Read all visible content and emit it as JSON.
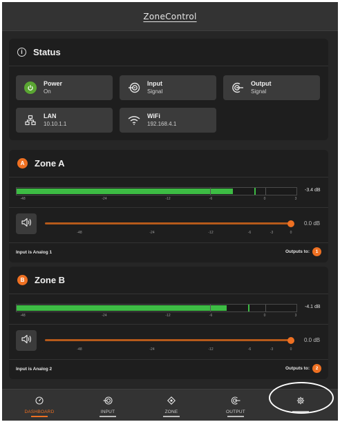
{
  "app": {
    "title": "ZoneControl"
  },
  "status": {
    "title": "Status",
    "tiles": [
      {
        "label": "Power",
        "value": "On",
        "icon": "power-icon",
        "color": "#5aa632"
      },
      {
        "label": "Input",
        "value": "Signal",
        "icon": "input-signal-icon"
      },
      {
        "label": "Output",
        "value": "Signal",
        "icon": "output-signal-icon"
      },
      {
        "label": "LAN",
        "value": "10.10.1.1",
        "icon": "lan-icon"
      },
      {
        "label": "WiFi",
        "value": "192.168.4.1",
        "icon": "wifi-icon"
      }
    ]
  },
  "zones": [
    {
      "badge": "A",
      "name": "Zone A",
      "meter_level_db": -3.4,
      "meter_readout": "-3.4 dB",
      "meter_scale": [
        "-48",
        "-24",
        "-12",
        "-6",
        "0",
        "3"
      ],
      "gain_db": 0.0,
      "gain_readout": "0.0 dB",
      "gain_scale": [
        "-48",
        "-24",
        "-12",
        "-6",
        "-3",
        "0"
      ],
      "input_text": "Input is Analog 1",
      "outputs_label": "Outputs to:",
      "outputs_badge": "1"
    },
    {
      "badge": "B",
      "name": "Zone B",
      "meter_level_db": -4.1,
      "meter_readout": "-4.1 dB",
      "meter_scale": [
        "-48",
        "-24",
        "-12",
        "-6",
        "0",
        "3"
      ],
      "gain_db": 0.0,
      "gain_readout": "0.0 dB",
      "gain_scale": [
        "-48",
        "-24",
        "-12",
        "-6",
        "-3",
        "0"
      ],
      "input_text": "Input is Analog 2",
      "outputs_label": "Outputs to:",
      "outputs_badge": "2"
    }
  ],
  "nav": {
    "items": [
      {
        "label": "DASHBOARD",
        "icon": "gauge-icon",
        "active": true
      },
      {
        "label": "INPUT",
        "icon": "input-icon",
        "active": false
      },
      {
        "label": "ZONE",
        "icon": "zone-icon",
        "active": false
      },
      {
        "label": "OUTPUT",
        "icon": "output-icon",
        "active": false
      },
      {
        "label": "",
        "icon": "gear-icon",
        "active": false
      }
    ]
  },
  "colors": {
    "accent": "#ee7022",
    "meter_green": "#3dbc44",
    "power_green": "#5aa632",
    "background": "#262626"
  }
}
